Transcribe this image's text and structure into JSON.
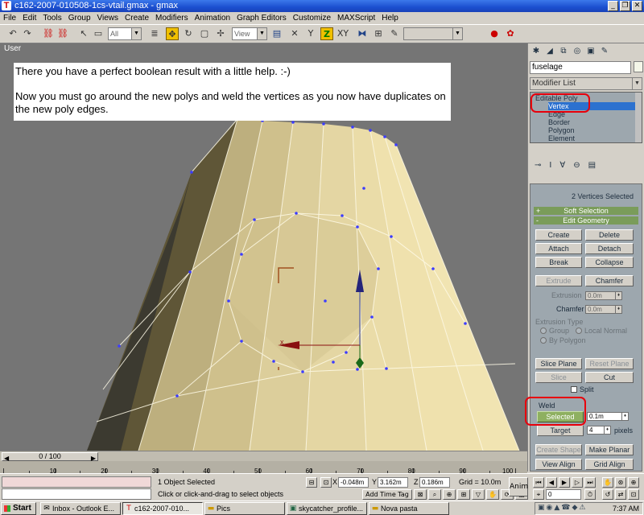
{
  "window": {
    "title": "c162-2007-010508-1cs-vtail.gmax - gmax",
    "app_icon": "gmax-icon"
  },
  "menu": [
    "File",
    "Edit",
    "Tools",
    "Group",
    "Views",
    "Create",
    "Modifiers",
    "Animation",
    "Graph Editors",
    "Customize",
    "MAXScript",
    "Help"
  ],
  "toolbar": {
    "selection_filter": "All",
    "ref_coord": "View",
    "named_selection": ""
  },
  "viewport": {
    "label": "User",
    "tutorial_lines": [
      "There you have a perfect boolean result with a little help. :-)",
      "Now you must go around the new polys and weld the vertices as you now have duplicates on the new poly edges."
    ]
  },
  "command_panel": {
    "object_name": "fuselage",
    "modifier_list": "Modifier List",
    "stack": {
      "root": "Editable Poly",
      "items": [
        "Vertex",
        "Edge",
        "Border",
        "Polygon",
        "Element"
      ],
      "selected_index": 0
    },
    "selection_info": "2 Vertices Selected",
    "soft_selection": {
      "sign": "+",
      "label": "Soft Selection"
    },
    "edit_geometry": {
      "sign": "-",
      "label": "Edit Geometry"
    },
    "buttons": {
      "create": "Create",
      "delete": "Delete",
      "attach": "Attach",
      "detach": "Detach",
      "break": "Break",
      "collapse": "Collapse",
      "extrude": "Extrude",
      "chamfer": "Chamfer",
      "slice_plane": "Slice Plane",
      "reset_plane": "Reset Plane",
      "slice": "Slice",
      "cut": "Cut",
      "weld_selected": "Selected",
      "weld_target": "Target",
      "create_shape": "Create Shape",
      "make_planar": "Make Planar",
      "view_align": "View Align",
      "grid_align": "Grid Align"
    },
    "extrusion": {
      "label": "Extrusion",
      "value": "0.0m"
    },
    "chamfer_amt": {
      "label": "Chamfer",
      "value": "0.0m"
    },
    "extrusion_type": {
      "label": "Extrusion Type",
      "group": "Group",
      "local_normal": "Local Normal",
      "by_polygon": "By Polygon"
    },
    "split": {
      "label": "Split",
      "checked": false
    },
    "weld": {
      "label": "Weld",
      "threshold": "0.1m",
      "target_pixels": "4",
      "pixels_label": "pixels"
    }
  },
  "timeline": {
    "frame": "0 / 100",
    "ticks": [
      10,
      20,
      30,
      40,
      50,
      60,
      70,
      80,
      90,
      100
    ],
    "max": 100
  },
  "status": {
    "selected": "1 Object Selected",
    "prompt": "Click or click-and-drag to select objects",
    "x": "-0.048m",
    "y": "3.162m",
    "z": "0.186m",
    "grid": "Grid = 10.0m",
    "add_time_tag": "Add Time Tag",
    "anim": "Anim",
    "frame_field": "0"
  },
  "taskbar": {
    "start": "Start",
    "tasks": [
      "Inbox - Outlook E...",
      "c162-2007-010...",
      "Pics",
      "skycatcher_profile...",
      "Nova pasta"
    ],
    "active_index": 1,
    "clock": "7:37 AM"
  },
  "colors": {
    "highlight": "#e8000b",
    "viewport_bg": "#757575",
    "mesh_light": "#ebdca4",
    "mesh_dark": "#7d7046",
    "vertex": "#3c3cff",
    "rollout_header": "#7a9c5a"
  }
}
